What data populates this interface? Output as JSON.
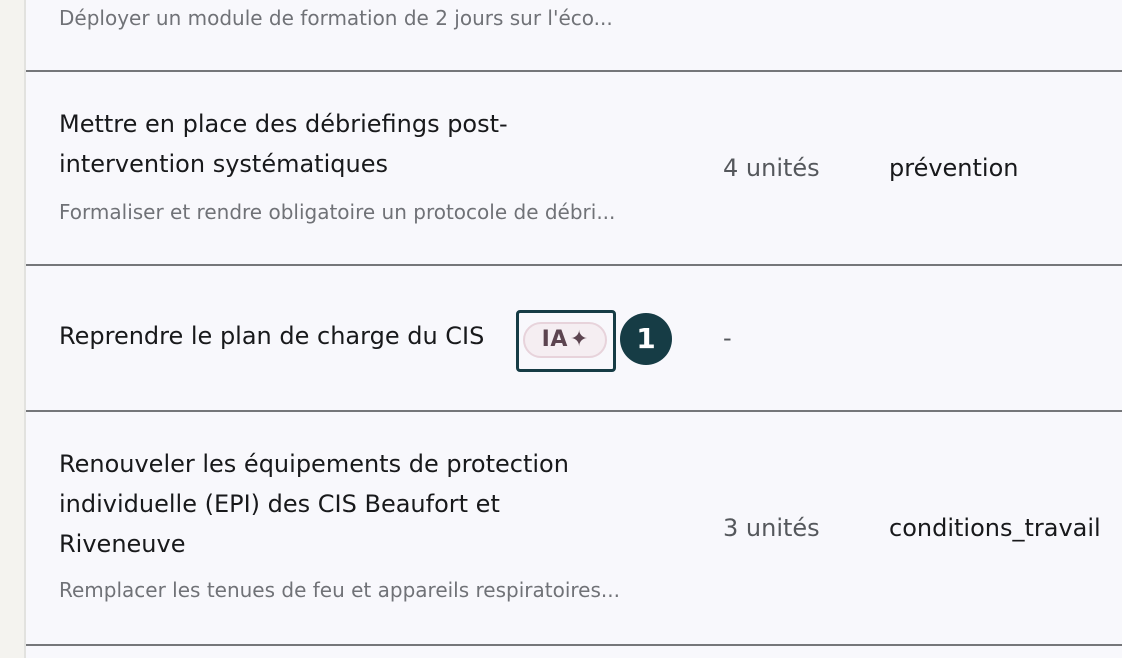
{
  "rows": [
    {
      "title": "",
      "description": "Déployer un module de formation de 2 jours sur l'éco..."
    },
    {
      "title_line1": "Mettre en place des débriefings post-",
      "title_line2": "intervention systématiques",
      "description": "Formaliser et rendre obligatoire un protocole de débri...",
      "units": "4 unités",
      "category": "prévention"
    },
    {
      "title": "Reprendre le plan de charge du CIS",
      "badge_label": "IA",
      "badge_icon": "sparkle-icon",
      "step_number": "1",
      "units": "-"
    },
    {
      "title_line1": "Renouveler les équipements de protection",
      "title_line2": "individuelle (EPI) des CIS Beaufort et",
      "title_line3": "Riveneuve",
      "description": "Remplacer les tenues de feu et appareils respiratoires...",
      "units": "3 unités",
      "category": "conditions_travail"
    }
  ],
  "colors": {
    "accent": "#163c45",
    "badge_text": "#5c4450",
    "badge_bg": "#f5eef2",
    "divider": "#75777a"
  }
}
